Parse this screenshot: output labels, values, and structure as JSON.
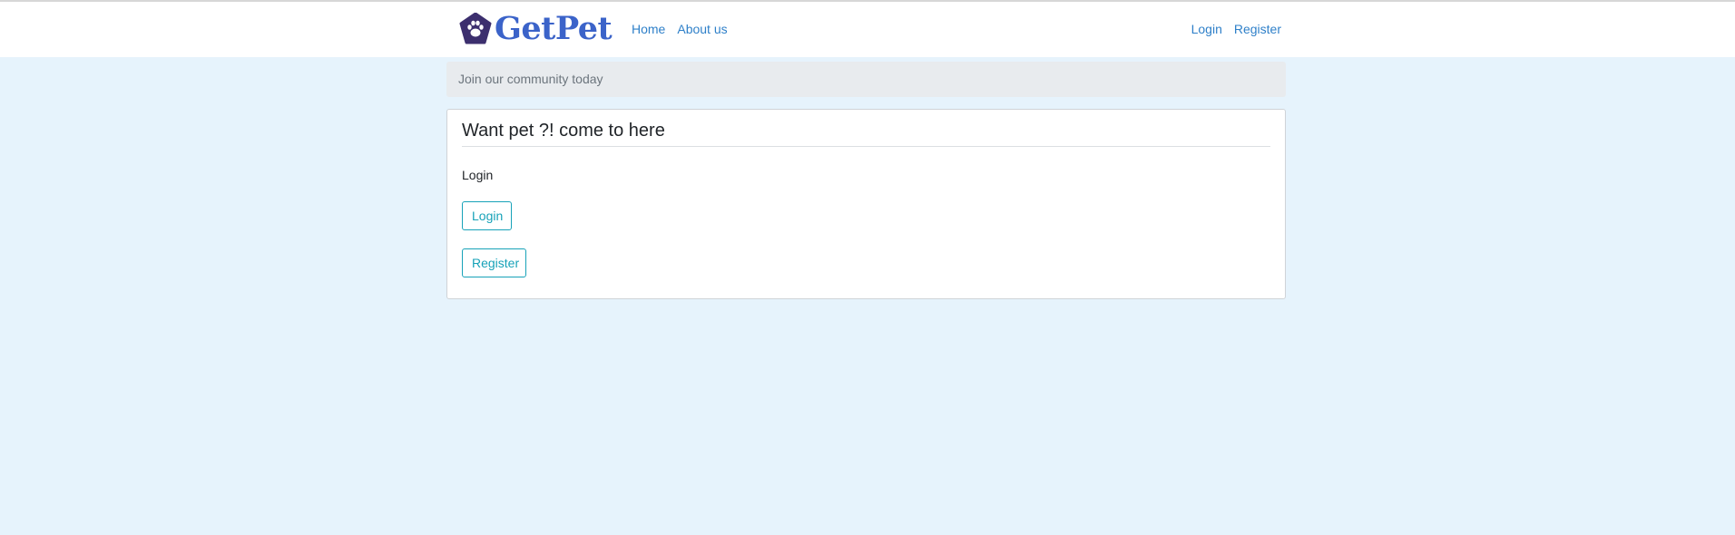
{
  "navbar": {
    "brand_name": "GetPet",
    "brand_icon": "paw-icon",
    "links": {
      "home": "Home",
      "about": "About us",
      "login": "Login",
      "register": "Register"
    }
  },
  "breadcrumb": {
    "text": "Join our community today"
  },
  "card": {
    "title": "Want pet ?! come to here",
    "section_label": "Login",
    "login_button": "Login",
    "register_button": "Register"
  },
  "colors": {
    "page_background": "#e6f3fc",
    "brand": "#3b63c9",
    "link": "#2f80c9",
    "button_outline": "#17a2b8",
    "logo_badge": "#3c2f6e"
  }
}
